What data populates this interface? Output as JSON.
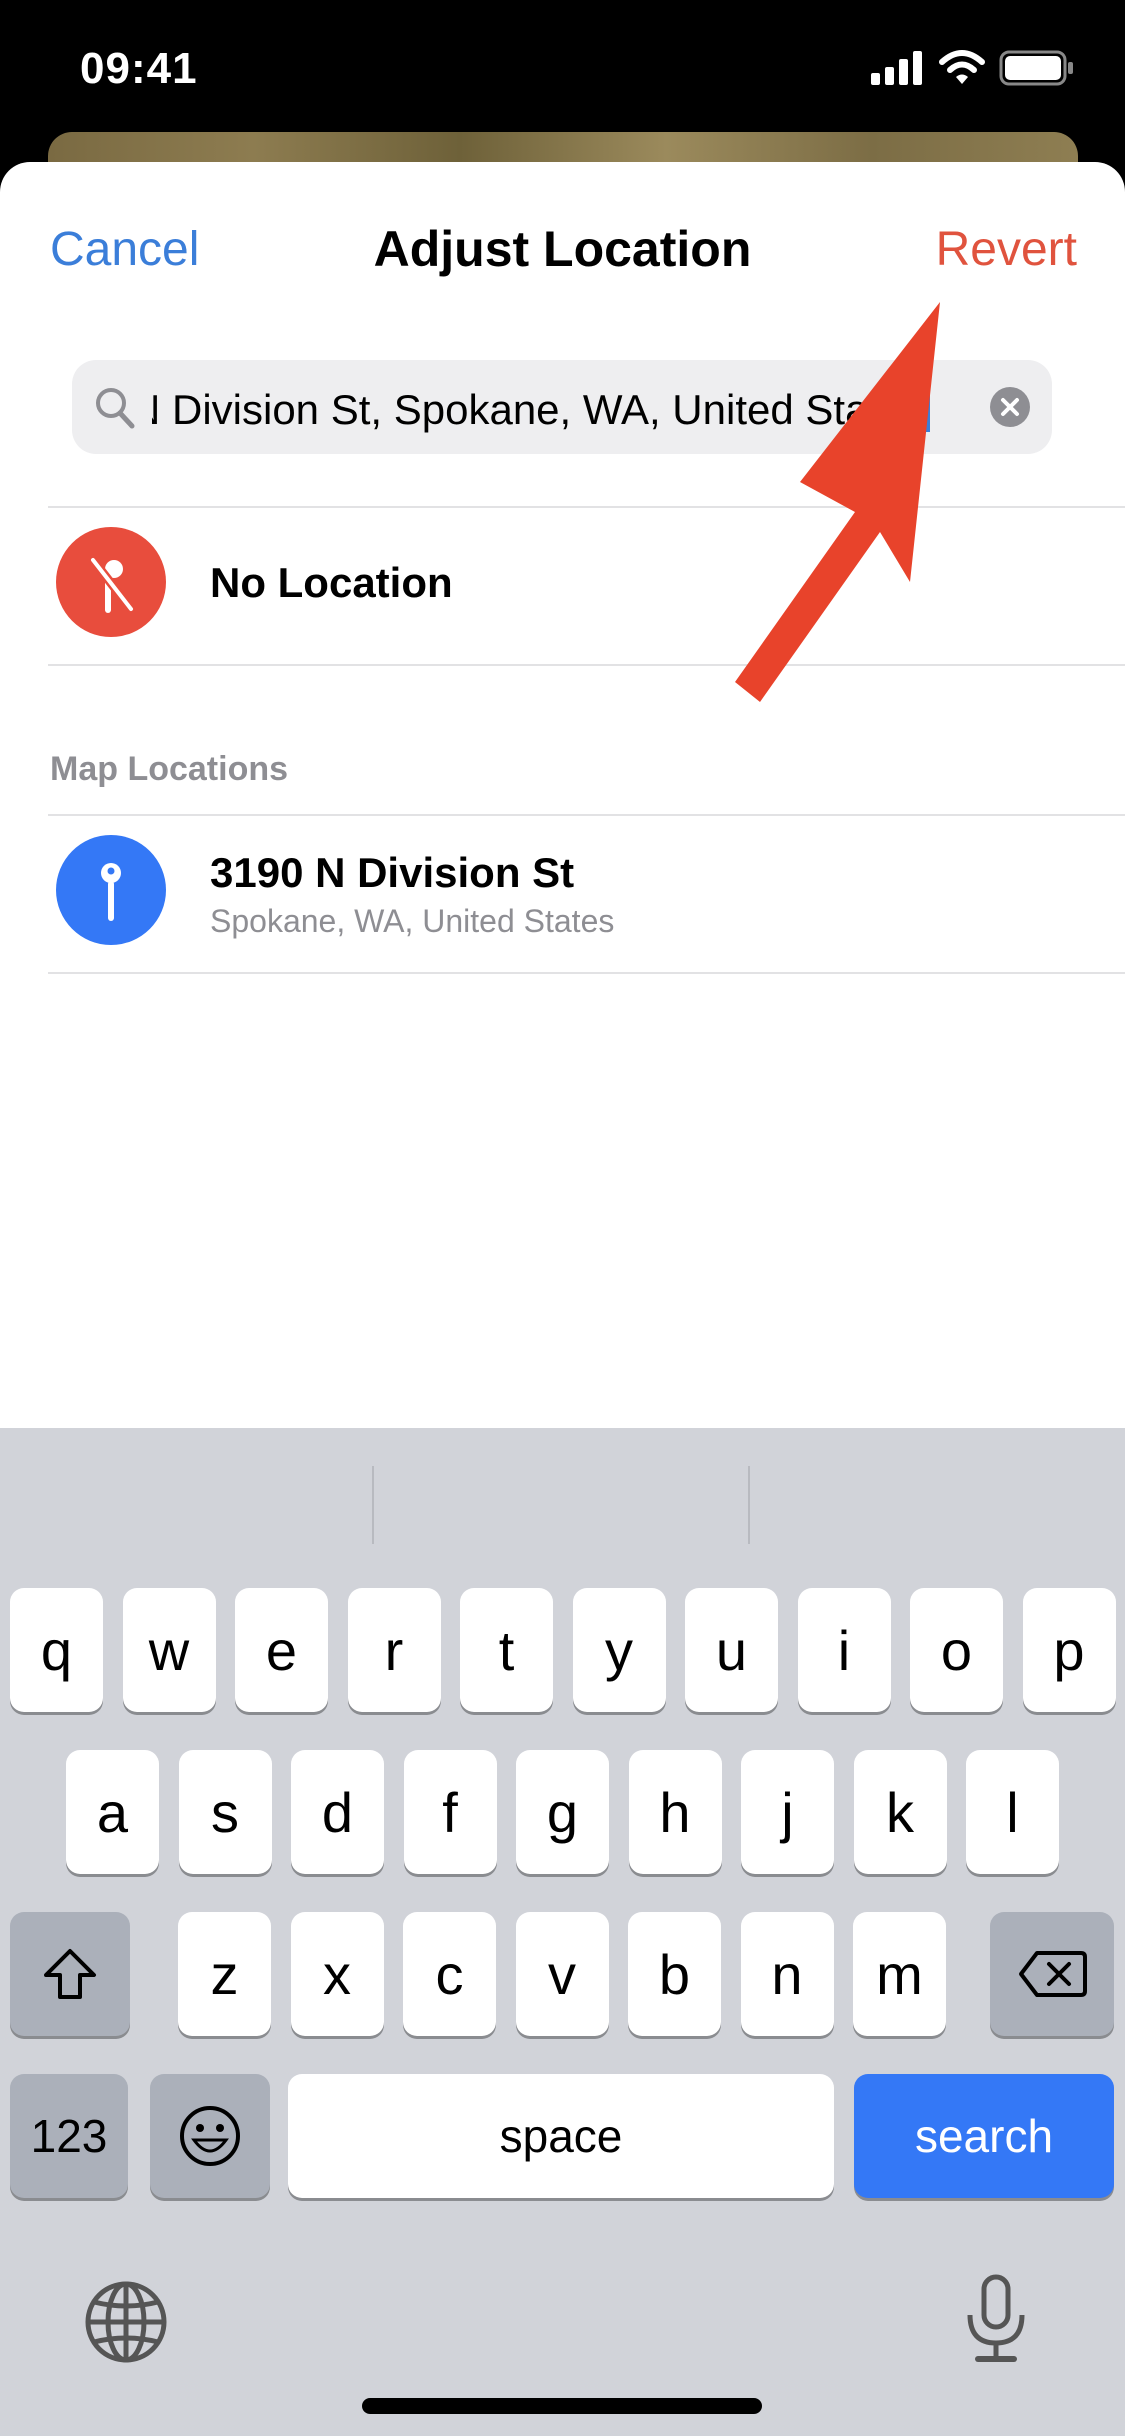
{
  "status_bar": {
    "time": "09:41",
    "icons": [
      "cellular-signal-icon",
      "wifi-icon",
      "battery-icon"
    ]
  },
  "nav": {
    "cancel_label": "Cancel",
    "title": "Adjust Location",
    "revert_label": "Revert"
  },
  "search": {
    "value": "N Division St, Spokane, WA, United States",
    "icon": "search-icon",
    "clear_icon": "clear-icon"
  },
  "no_location": {
    "label": "No Location",
    "icon": "location-slash-icon"
  },
  "map_locations": {
    "header": "Map Locations",
    "items": [
      {
        "title": "3190 N Division St",
        "subtitle": "Spokane, WA, United States",
        "icon": "map-pin-icon"
      }
    ]
  },
  "annotation": {
    "type": "red-arrow",
    "points_to": "Revert"
  },
  "keyboard": {
    "row1": [
      "q",
      "w",
      "e",
      "r",
      "t",
      "y",
      "u",
      "i",
      "o",
      "p"
    ],
    "row2": [
      "a",
      "s",
      "d",
      "f",
      "g",
      "h",
      "j",
      "k",
      "l"
    ],
    "row3": [
      "z",
      "x",
      "c",
      "v",
      "b",
      "n",
      "m"
    ],
    "numbers_label": "123",
    "space_label": "space",
    "return_label": "search"
  },
  "colors": {
    "accent_blue": "#3b7ed9",
    "revert_red": "#e0533e",
    "no_location_red": "#e84d3d",
    "pin_blue": "#3478f6",
    "keyboard_bg": "#d1d3d9"
  }
}
